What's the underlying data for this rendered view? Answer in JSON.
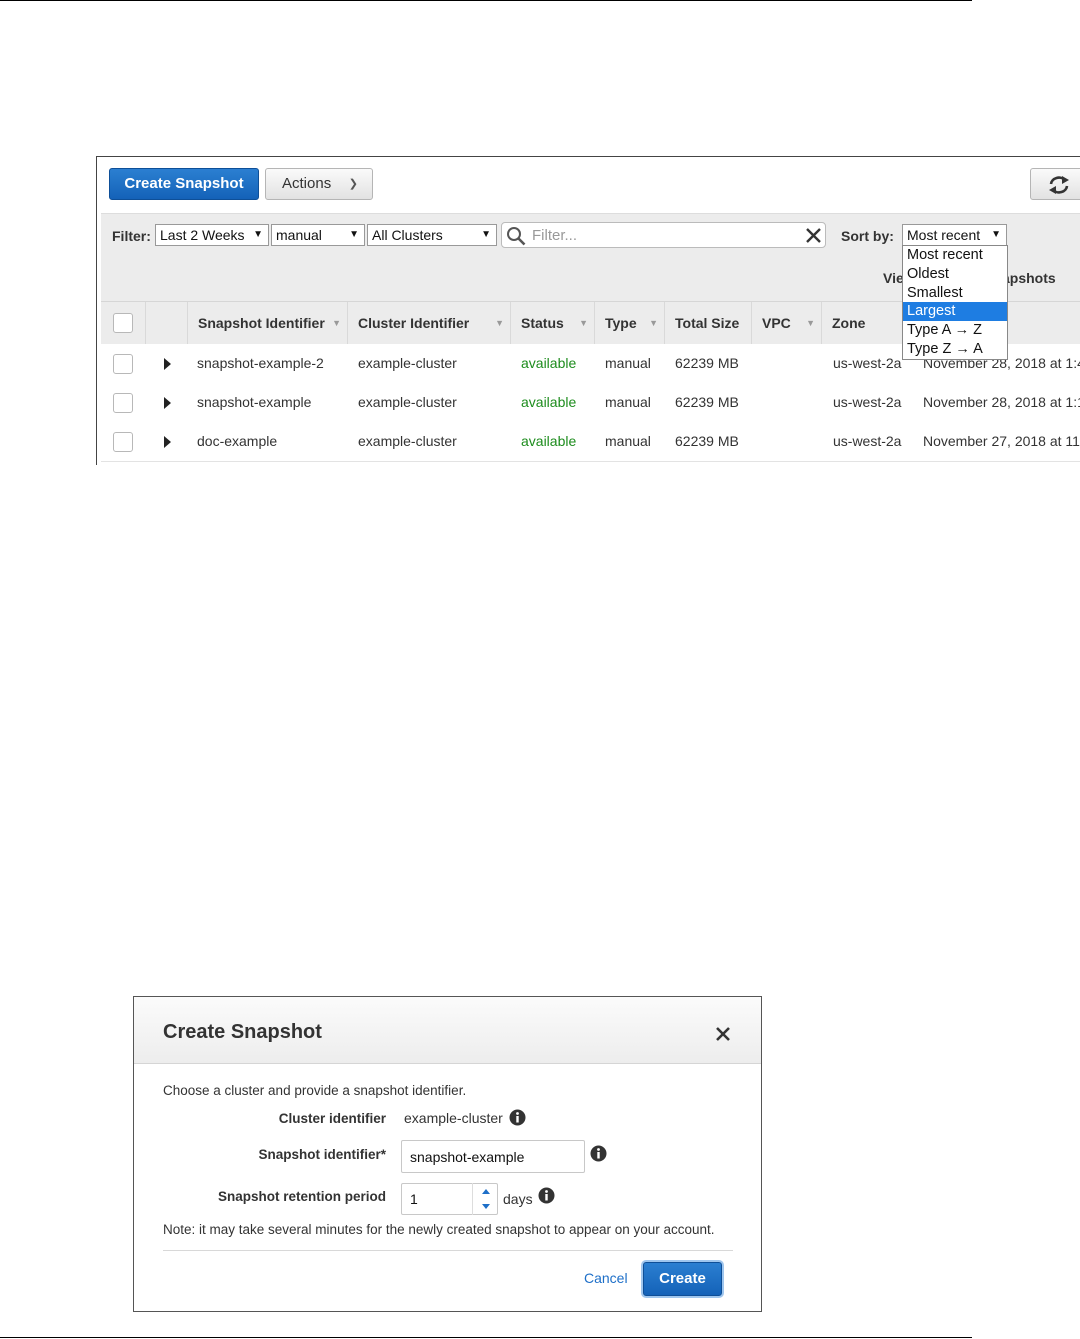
{
  "toolbar": {
    "create_snapshot": "Create Snapshot",
    "actions": "Actions"
  },
  "filter": {
    "label": "Filter:",
    "time_range": "Last 2 Weeks",
    "type": "manual",
    "cluster": "All Clusters",
    "search_placeholder": "Filter...",
    "sort_label": "Sort by:",
    "sort_value": "Most recent",
    "view_partial_left": "Vie",
    "view_partial_right": "apshots"
  },
  "sort_options": [
    "Most recent",
    "Oldest",
    "Smallest",
    "Largest",
    "Type A → Z",
    "Type Z → A"
  ],
  "sort_highlighted": "Largest",
  "table": {
    "columns": [
      "Snapshot Identifier",
      "Cluster Identifier",
      "Status",
      "Type",
      "Total Size",
      "VPC",
      "Zone"
    ],
    "rows": [
      {
        "snapshot": "snapshot-example-2",
        "cluster": "example-cluster",
        "status": "available",
        "type": "manual",
        "size": "62239 MB",
        "vpc": "",
        "zone": "us-west-2a",
        "created": "November 28, 2018 at 1:4"
      },
      {
        "snapshot": "snapshot-example",
        "cluster": "example-cluster",
        "status": "available",
        "type": "manual",
        "size": "62239 MB",
        "vpc": "",
        "zone": "us-west-2a",
        "created": "November 28, 2018 at 1:1"
      },
      {
        "snapshot": "doc-example",
        "cluster": "example-cluster",
        "status": "available",
        "type": "manual",
        "size": "62239 MB",
        "vpc": "",
        "zone": "us-west-2a",
        "created": "November 27, 2018 at 11"
      }
    ]
  },
  "modal": {
    "title": "Create Snapshot",
    "description": "Choose a cluster and provide a snapshot identifier.",
    "cluster_label": "Cluster identifier",
    "cluster_value": "example-cluster",
    "snapshot_label": "Snapshot identifier*",
    "snapshot_value": "snapshot-example",
    "retention_label": "Snapshot retention period",
    "retention_value": "1",
    "retention_unit": "days",
    "note": "Note: it may take several minutes for the newly created snapshot to appear on your account.",
    "cancel": "Cancel",
    "create": "Create"
  },
  "colors": {
    "primary": "#1e6fc8",
    "status_available": "#1d8c1d",
    "highlight": "#1e7de2"
  }
}
